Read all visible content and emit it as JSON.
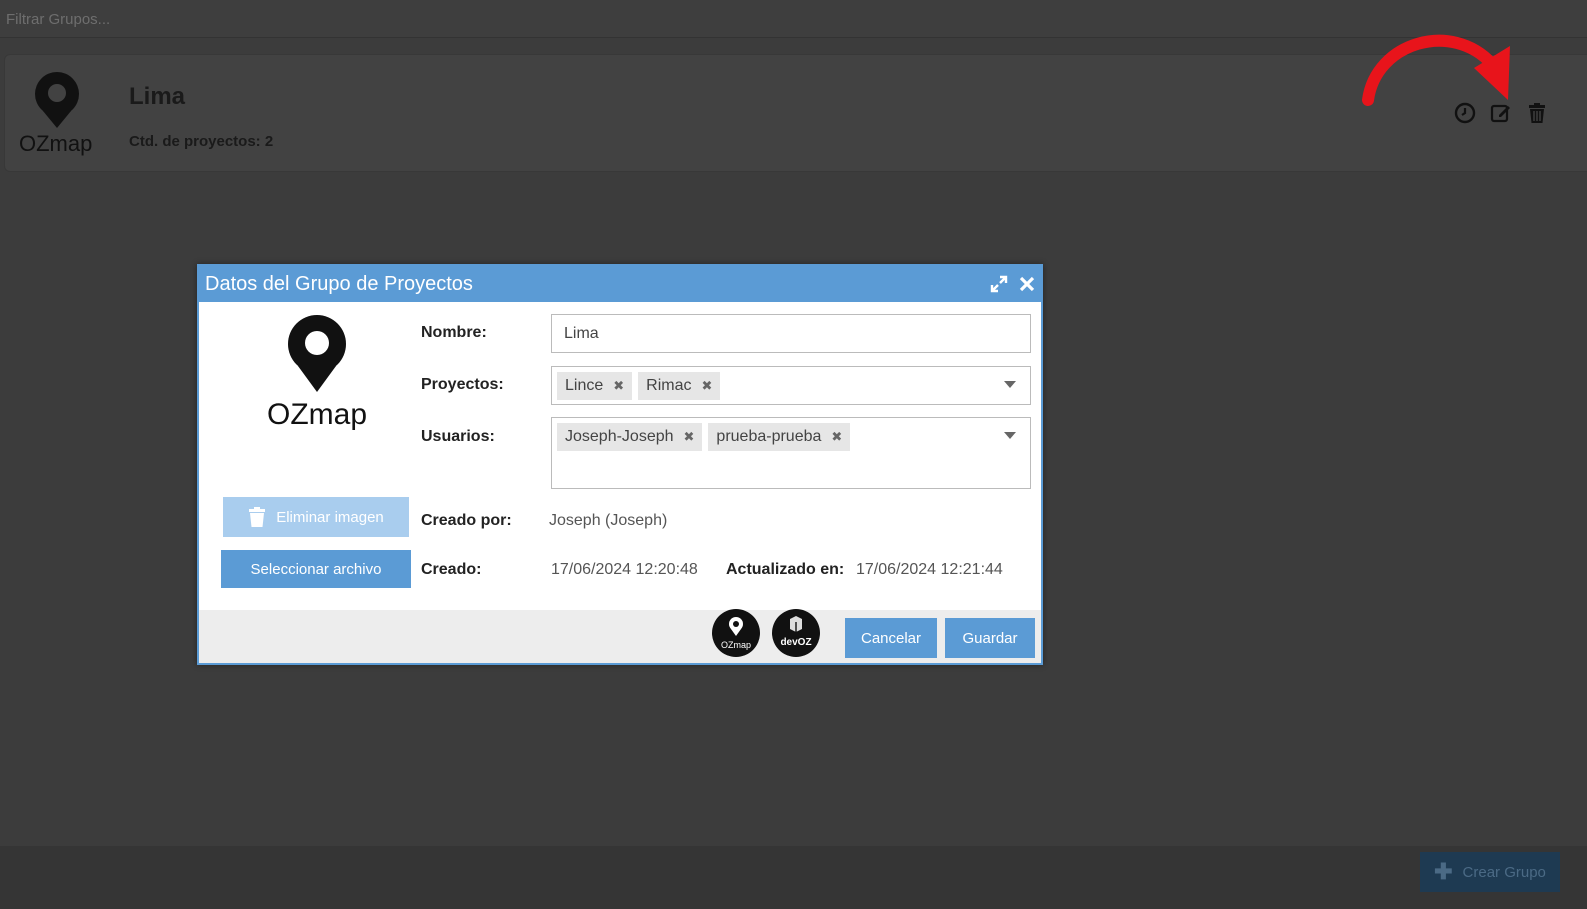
{
  "filter": {
    "placeholder": "Filtrar Grupos..."
  },
  "group": {
    "title": "Lima",
    "count_label": "Ctd. de proyectos: 2",
    "logo_text": "OZmap"
  },
  "footer": {
    "create_label": "Crear Grupo"
  },
  "modal": {
    "title": "Datos del Grupo de Proyectos",
    "logo_text": "OZmap",
    "remove_image_label": "Eliminar imagen",
    "select_file_label": "Seleccionar archivo",
    "fields": {
      "name_label": "Nombre:",
      "name_value": "Lima",
      "projects_label": "Proyectos:",
      "projects": [
        "Lince",
        "Rimac"
      ],
      "users_label": "Usuarios:",
      "users": [
        "Joseph-Joseph",
        "prueba-prueba"
      ],
      "created_by_label": "Creado por:",
      "created_by_value": "Joseph (Joseph)",
      "created_label": "Creado:",
      "created_value": "17/06/2024 12:20:48",
      "updated_label": "Actualizado en:",
      "updated_value": "17/06/2024 12:21:44"
    },
    "footer_logos": [
      "OZmap",
      "devOZ"
    ],
    "cancel_label": "Cancelar",
    "save_label": "Guardar"
  },
  "colors": {
    "accent": "#5b9bd5",
    "annotation": "#e8141b"
  }
}
